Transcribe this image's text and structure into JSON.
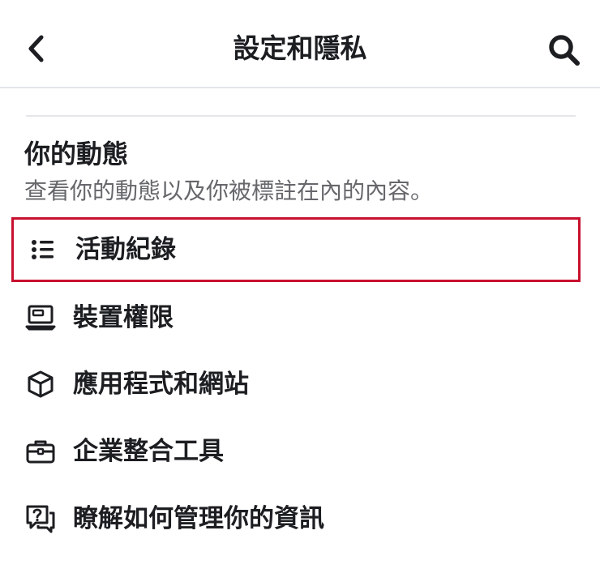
{
  "header": {
    "title": "設定和隱私",
    "back_icon": "chevron-left-icon",
    "search_icon": "search-icon"
  },
  "section": {
    "title": "你的動態",
    "subtitle": "查看你的動態以及你被標註在內的內容。"
  },
  "menu": {
    "items": [
      {
        "label": "活動紀錄",
        "icon": "list-icon",
        "highlighted": true
      },
      {
        "label": "裝置權限",
        "icon": "laptop-icon",
        "highlighted": false
      },
      {
        "label": "應用程式和網站",
        "icon": "cube-icon",
        "highlighted": false
      },
      {
        "label": "企業整合工具",
        "icon": "briefcase-icon",
        "highlighted": false
      },
      {
        "label": "瞭解如何管理你的資訊",
        "icon": "help-chat-icon",
        "highlighted": false
      }
    ]
  },
  "colors": {
    "highlight_border": "#c8102e",
    "text_primary": "#1c1e21",
    "text_secondary": "#65676b",
    "divider": "#e4e6eb"
  }
}
